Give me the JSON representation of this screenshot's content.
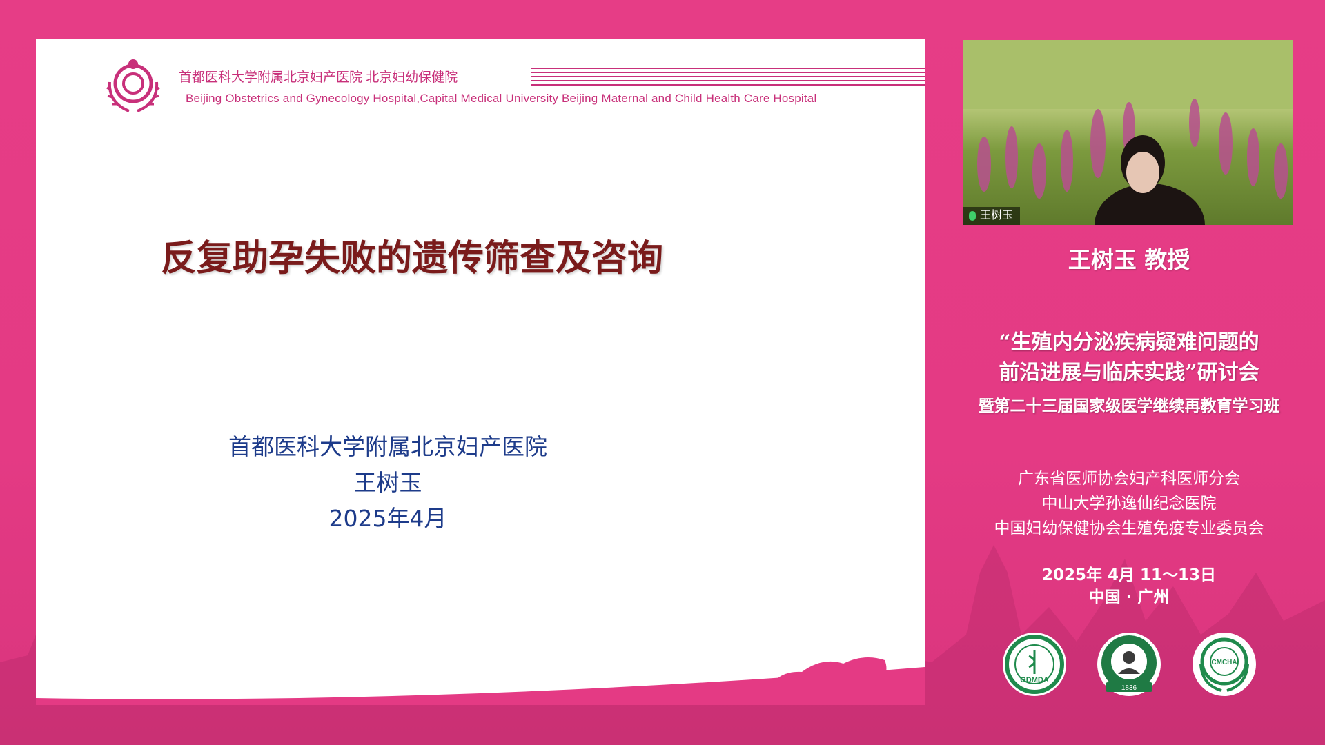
{
  "slide": {
    "hospital_cn": "首都医科大学附属北京妇产医院 北京妇幼保健院",
    "hospital_en": "Beijing Obstetrics and Gynecology Hospital,Capital Medical University Beijing Maternal and Child Health Care Hospital",
    "title": "反复助孕失败的遗传筛查及咨询",
    "affiliation": "首都医科大学附属北京妇产医院",
    "presenter": "王树玉",
    "date": "2025年4月"
  },
  "video": {
    "participant_name": "王树玉"
  },
  "panel": {
    "speaker_title": "王树玉 教授",
    "event_title_line1": "“生殖内分泌疾病疑难问题的",
    "event_title_line2": "前沿进展与临床实践”研讨会",
    "event_subtitle": "暨第二十三届国家级医学继续再教育学习班",
    "organizers": [
      "广东省医师协会妇产科医师分会",
      "中山大学孙逸仙纪念医院",
      "中国妇幼保健协会生殖免疫专业委员会"
    ],
    "date": "2025年 4月 11～13日",
    "location": "中国 · 广州",
    "badges": [
      "GDMDA",
      "1836",
      "CMCHA"
    ]
  },
  "colors": {
    "background": "#e43a84",
    "title_red": "#7a1b1b",
    "text_blue": "#1d3b8a",
    "hospital_pink": "#c8307a"
  }
}
